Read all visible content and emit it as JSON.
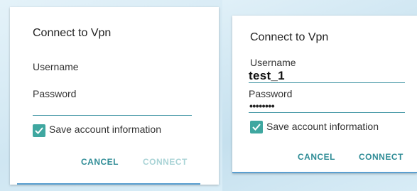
{
  "dialog_empty": {
    "title": "Connect to Vpn",
    "username_label": "Username",
    "username_value": "",
    "password_label": "Password",
    "password_value": "",
    "save_label": "Save account information",
    "save_checked": true,
    "cancel_label": "CANCEL",
    "connect_label": "CONNECT",
    "connect_enabled": false
  },
  "dialog_filled": {
    "title": "Connect to Vpn",
    "username_label": "Username",
    "username_value": "test_1",
    "password_label": "Password",
    "password_value": "••••••••",
    "save_label": "Save account information",
    "save_checked": true,
    "cancel_label": "CANCEL",
    "connect_label": "CONNECT",
    "connect_enabled": true
  },
  "colors": {
    "accent": "#2f8c96",
    "accent_disabled": "#a9d3d6",
    "checkbox": "#3fa7a0",
    "underline": "#5a9fd0"
  },
  "icons": {
    "checkbox_icon": "check-icon"
  }
}
